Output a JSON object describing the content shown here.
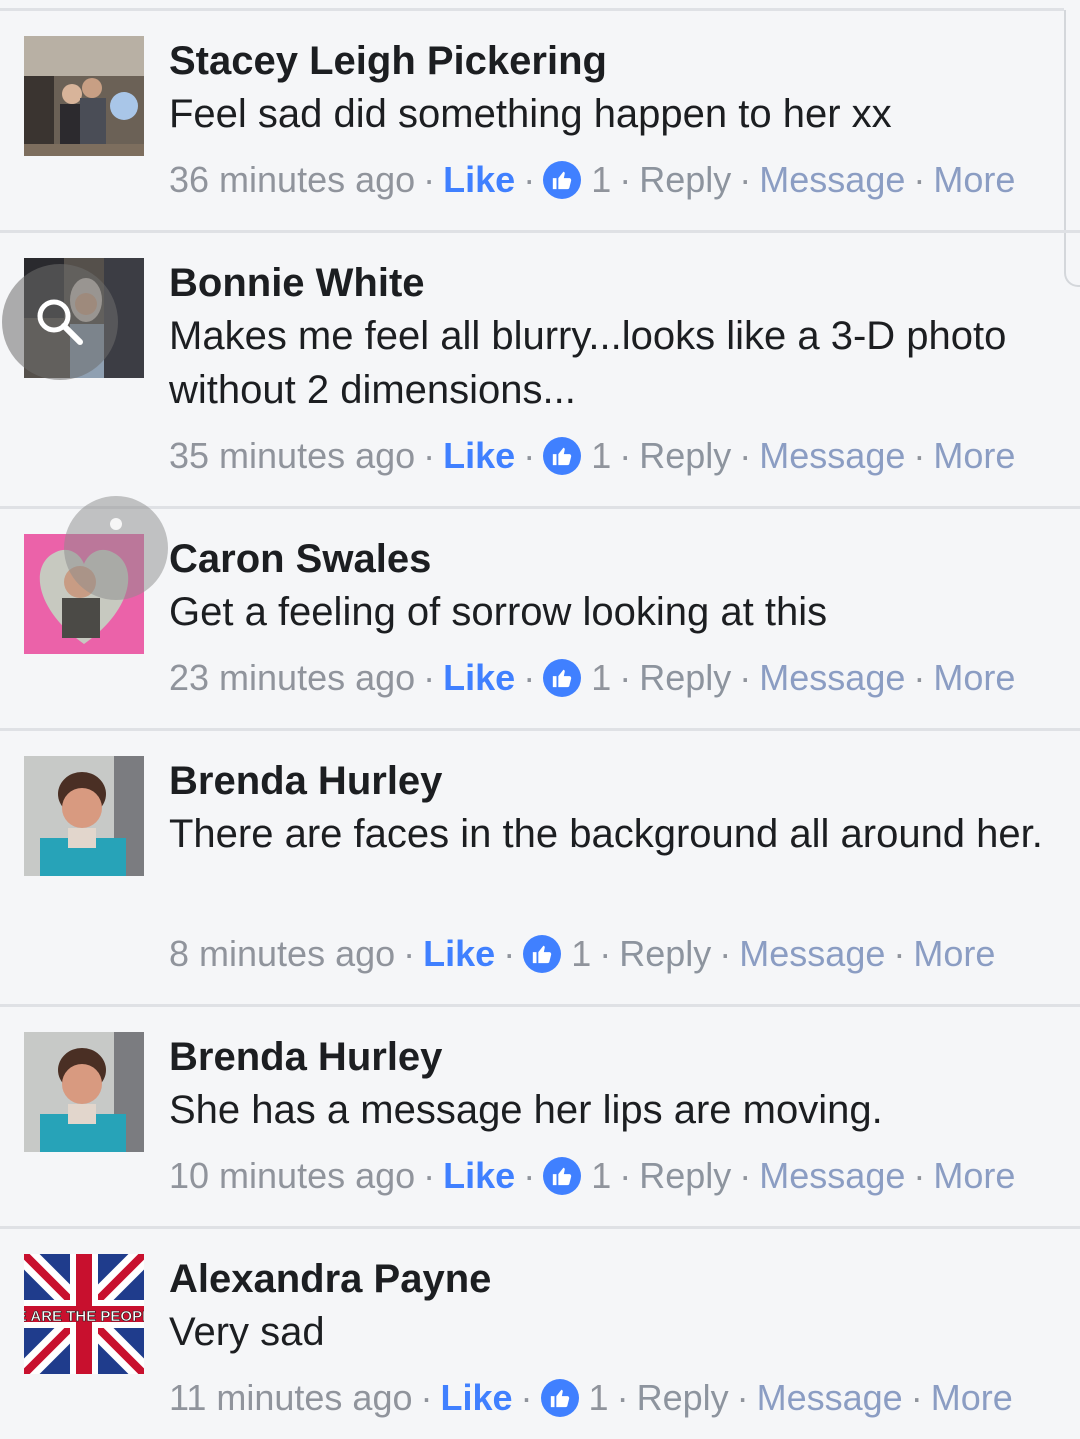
{
  "comments": [
    {
      "author": "Stacey Leigh Pickering",
      "text": "Feel sad did something happen to her xx",
      "time": "36 minutes ago",
      "like_label": "Like",
      "like_count": "1",
      "reply_label": "Reply",
      "message_label": "Message",
      "more_label": "More"
    },
    {
      "author": "Bonnie White",
      "text": "Makes me feel all blurry...looks like a 3-D photo without 2 dimensions...",
      "time": "35 minutes ago",
      "like_label": "Like",
      "like_count": "1",
      "reply_label": "Reply",
      "message_label": "Message",
      "more_label": "More"
    },
    {
      "author": "Caron Swales",
      "text": "Get a feeling of sorrow looking at this",
      "time": "23 minutes ago",
      "like_label": "Like",
      "like_count": "1",
      "reply_label": "Reply",
      "message_label": "Message",
      "more_label": "More"
    },
    {
      "author": "Brenda Hurley",
      "text": "There are faces in the background all around her.",
      "time": "8 minutes ago",
      "like_label": "Like",
      "like_count": "1",
      "reply_label": "Reply",
      "message_label": "Message",
      "more_label": "More"
    },
    {
      "author": "Brenda Hurley",
      "text": "She has a message her lips are moving.",
      "time": "10 minutes ago",
      "like_label": "Like",
      "like_count": "1",
      "reply_label": "Reply",
      "message_label": "Message",
      "more_label": "More"
    },
    {
      "author": "Alexandra Payne",
      "text": "Very sad",
      "time": "11 minutes ago",
      "like_label": "Like",
      "like_count": "1",
      "reply_label": "Reply",
      "message_label": "Message",
      "more_label": "More"
    }
  ],
  "avatar_images": {
    "avatar_6_banner": "E ARE THE PEOPL"
  },
  "colors": {
    "like_blue": "#4080ff",
    "meta_gray": "#90949c",
    "link_blue_gray": "#8b9dc3",
    "background": "#f5f6f8",
    "divider": "#dfe1e5"
  },
  "icons": {
    "like_badge": "thumbs-up-icon",
    "zoom_overlay": "magnifier-icon"
  }
}
